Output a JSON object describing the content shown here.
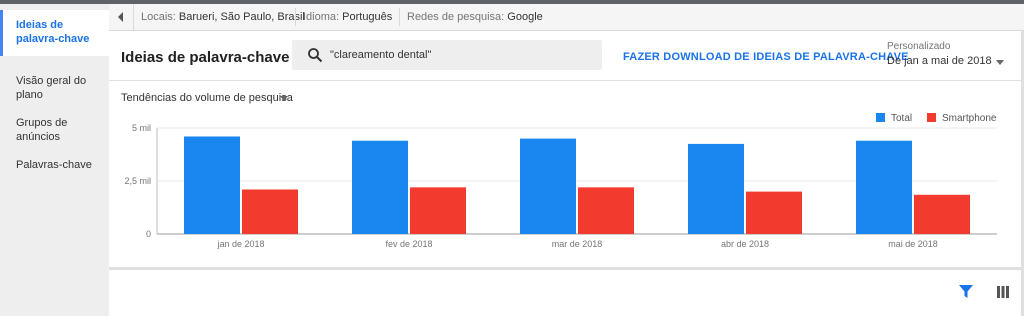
{
  "sidebar": {
    "items": [
      {
        "label": "Ideias de palavra-chave",
        "active": true
      },
      {
        "label": "Visão geral do plano"
      },
      {
        "label": "Grupos de anúncios"
      },
      {
        "label": "Palavras-chave"
      }
    ]
  },
  "filters": {
    "locations_label": "Locais:",
    "locations_value": "Barueri, São Paulo, Brasil",
    "language_label": "Idioma:",
    "language_value": "Português",
    "network_label": "Redes de pesquisa:",
    "network_value": "Google"
  },
  "header": {
    "title": "Ideias de palavra-chave",
    "search_value": "\"clareamento dental\"",
    "download_label": "FAZER DOWNLOAD DE IDEIAS DE PALAVRA-CHAVE",
    "date_range_label": "Personalizado",
    "date_range_value": "De jan a mai de 2018"
  },
  "chart_section": {
    "dropdown_label": "Tendências do volume de pesquisa"
  },
  "colors": {
    "total": "#1a87f0",
    "smartphone": "#f23b2e",
    "accent": "#1a73e8"
  },
  "chart_data": {
    "type": "bar",
    "categories": [
      "jan de 2018",
      "fev de 2018",
      "mar de 2018",
      "abr de 2018",
      "mai de 2018"
    ],
    "series": [
      {
        "name": "Total",
        "values": [
          4600,
          4400,
          4500,
          4250,
          4400
        ]
      },
      {
        "name": "Smartphone",
        "values": [
          2100,
          2200,
          2200,
          2000,
          1850
        ]
      }
    ],
    "y_ticks": [
      {
        "value": 0,
        "label": "0"
      },
      {
        "value": 2500,
        "label": "2,5 mil"
      },
      {
        "value": 5000,
        "label": "5 mil"
      }
    ],
    "ylim": [
      0,
      5000
    ],
    "grid": true,
    "legend_position": "top-right"
  }
}
